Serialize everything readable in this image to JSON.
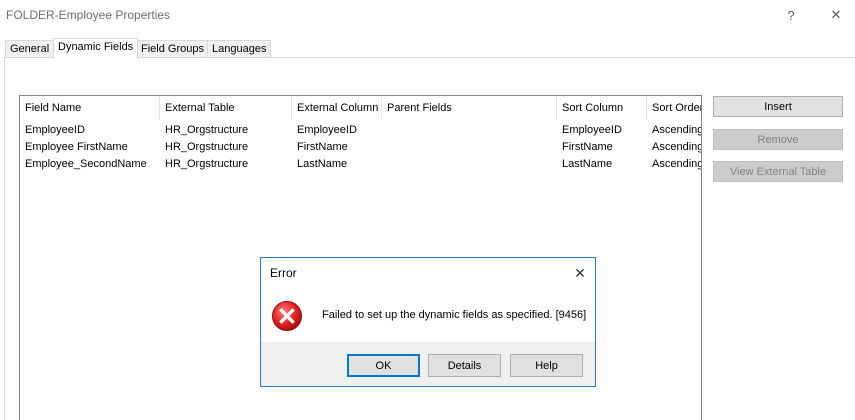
{
  "window": {
    "title": "FOLDER-Employee Properties",
    "help_glyph": "?",
    "close_glyph": "✕"
  },
  "tabs": [
    {
      "label": "General",
      "active": false
    },
    {
      "label": "Dynamic Fields",
      "active": true
    },
    {
      "label": "Field Groups",
      "active": false
    },
    {
      "label": "Languages",
      "active": false
    }
  ],
  "table": {
    "columns": [
      "Field Name",
      "External Table",
      "External Column",
      "Parent Fields",
      "Sort Column",
      "Sort Order"
    ],
    "rows": [
      [
        "EmployeeID",
        "HR_Orgstructure",
        "EmployeeID",
        "",
        "EmployeeID",
        "Ascending"
      ],
      [
        "Employee FirstName",
        "HR_Orgstructure",
        "FirstName",
        "",
        "FirstName",
        "Ascending"
      ],
      [
        "Employee_SecondName",
        "HR_Orgstructure",
        "LastName",
        "",
        "LastName",
        "Ascending"
      ]
    ]
  },
  "side_buttons": {
    "insert": "Insert",
    "remove": "Remove",
    "view_external_table": "View External Table"
  },
  "dialog": {
    "title": "Error",
    "close_glyph": "✕",
    "message": "Failed to set up the dynamic fields as specified. [9456]",
    "ok": "OK",
    "details": "Details",
    "help": "Help",
    "colors": {
      "error_red": "#e81123",
      "accent": "#0078d7"
    }
  }
}
